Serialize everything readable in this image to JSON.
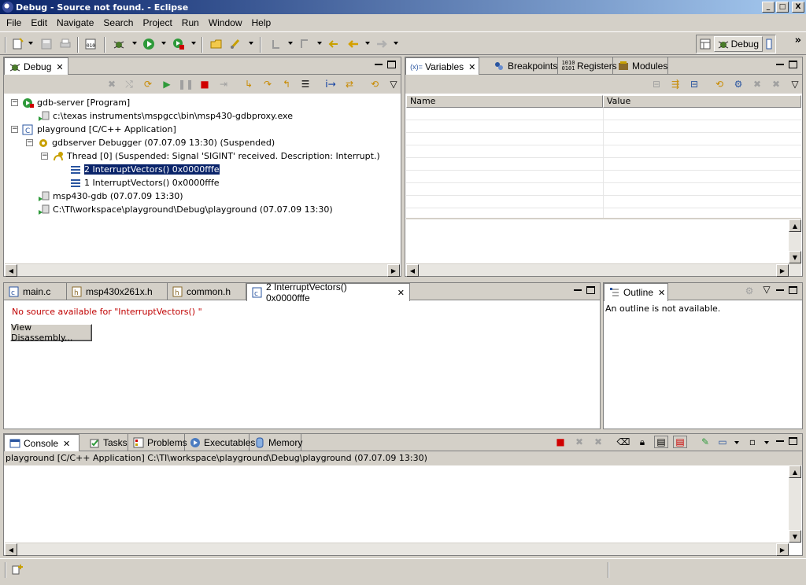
{
  "window": {
    "title": "Debug - Source not found. - Eclipse",
    "controls": {
      "minimize": "_",
      "maximize": "□",
      "close": "X"
    }
  },
  "menu": [
    "File",
    "Edit",
    "Navigate",
    "Search",
    "Project",
    "Run",
    "Window",
    "Help"
  ],
  "perspective": {
    "label": "Debug",
    "more": "»"
  },
  "debug_view": {
    "tab_label": "Debug",
    "tree": [
      {
        "label": "gdb-server [Program]"
      },
      {
        "label": "c:\\texas instruments\\mspgcc\\bin\\msp430-gdbproxy.exe"
      },
      {
        "label": "playground [C/C++ Application]"
      },
      {
        "label": "gdbserver Debugger (07.07.09 13:30) (Suspended)"
      },
      {
        "label": "Thread [0] (Suspended: Signal 'SIGINT' received. Description: Interrupt.)"
      },
      {
        "label": "2 InterruptVectors()  0x0000fffe"
      },
      {
        "label": "1 InterruptVectors()  0x0000fffe"
      },
      {
        "label": "msp430-gdb (07.07.09 13:30)"
      },
      {
        "label": "C:\\TI\\workspace\\playground\\Debug\\playground (07.07.09 13:30)"
      }
    ]
  },
  "variables_view": {
    "tabs": [
      "Variables",
      "Breakpoints",
      "Registers",
      "Modules"
    ],
    "columns": [
      "Name",
      "Value"
    ]
  },
  "editor": {
    "tabs": [
      "main.c",
      "msp430x261x.h",
      "common.h",
      "2 InterruptVectors()  0x0000fffe"
    ],
    "message": "No source available for \"InterruptVectors() \"",
    "button": "View Disassembly..."
  },
  "outline_view": {
    "tab_label": "Outline",
    "message": "An outline is not available."
  },
  "console_view": {
    "tabs": [
      "Console",
      "Tasks",
      "Problems",
      "Executables",
      "Memory"
    ],
    "description": "playground [C/C++ Application] C:\\TI\\workspace\\playground\\Debug\\playground (07.07.09 13:30)"
  },
  "colors": {
    "title_start": "#0a246a",
    "title_end": "#a6caf0",
    "error_text": "#c00000",
    "selection": "#0a246a"
  }
}
